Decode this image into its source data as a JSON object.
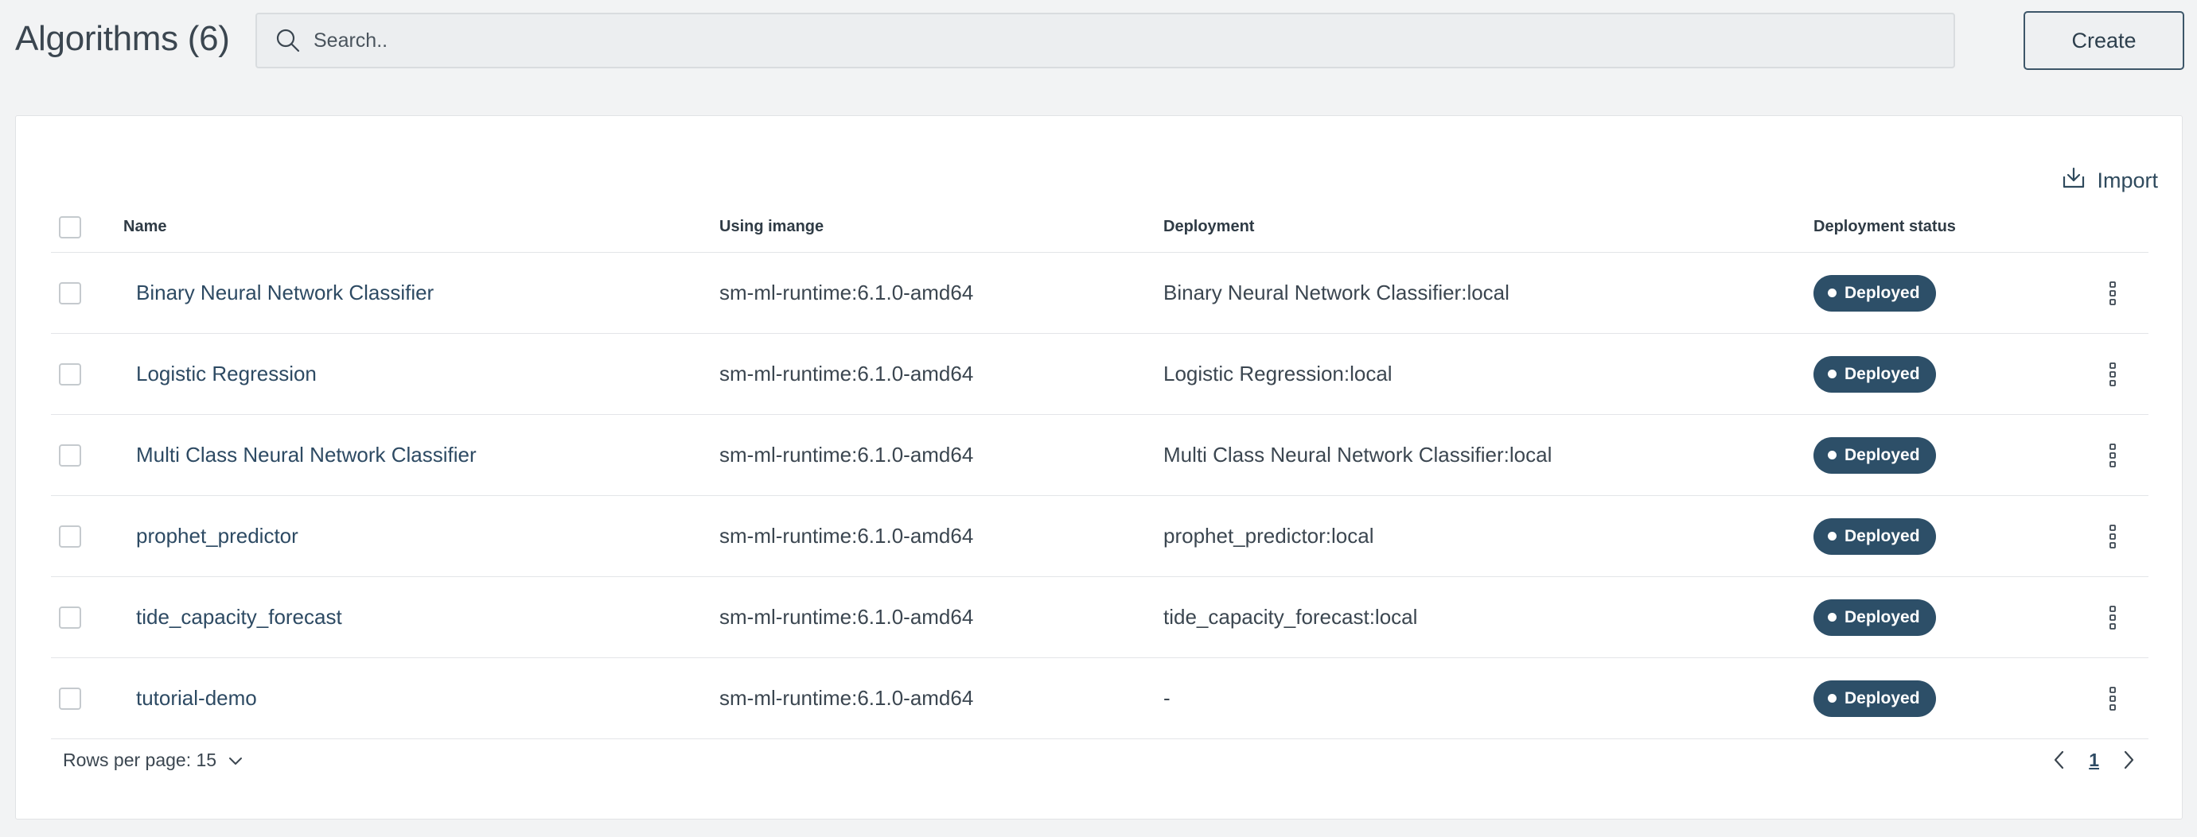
{
  "header": {
    "title": "Algorithms (6)",
    "search_placeholder": "Search..",
    "create_label": "Create"
  },
  "card": {
    "import_label": "Import"
  },
  "table": {
    "columns": [
      "Name",
      "Using imange",
      "Deployment",
      "Deployment status"
    ],
    "rows": [
      {
        "name": "Binary Neural Network Classifier",
        "image": "sm-ml-runtime:6.1.0-amd64",
        "deployment": "Binary Neural Network Classifier:local",
        "status": "Deployed"
      },
      {
        "name": "Logistic Regression",
        "image": "sm-ml-runtime:6.1.0-amd64",
        "deployment": "Logistic Regression:local",
        "status": "Deployed"
      },
      {
        "name": "Multi Class Neural Network Classifier",
        "image": "sm-ml-runtime:6.1.0-amd64",
        "deployment": "Multi Class Neural Network Classifier:local",
        "status": "Deployed"
      },
      {
        "name": "prophet_predictor",
        "image": "sm-ml-runtime:6.1.0-amd64",
        "deployment": "prophet_predictor:local",
        "status": "Deployed"
      },
      {
        "name": "tide_capacity_forecast",
        "image": "sm-ml-runtime:6.1.0-amd64",
        "deployment": "tide_capacity_forecast:local",
        "status": "Deployed"
      },
      {
        "name": "tutorial-demo",
        "image": "sm-ml-runtime:6.1.0-amd64",
        "deployment": "-",
        "status": "Deployed"
      }
    ]
  },
  "footer": {
    "rows_per_page": "Rows per page: 15",
    "current_page": "1"
  },
  "icons": {
    "search": "search-icon",
    "import": "import-icon",
    "row_menu": "kebab-menu-icon",
    "dropdown": "chevron-down-icon",
    "prev": "chevron-left-icon",
    "next": "chevron-right-icon"
  },
  "colors": {
    "accent": "#2d4f68",
    "link": "#2d4a63",
    "background": "#f2f3f4"
  }
}
